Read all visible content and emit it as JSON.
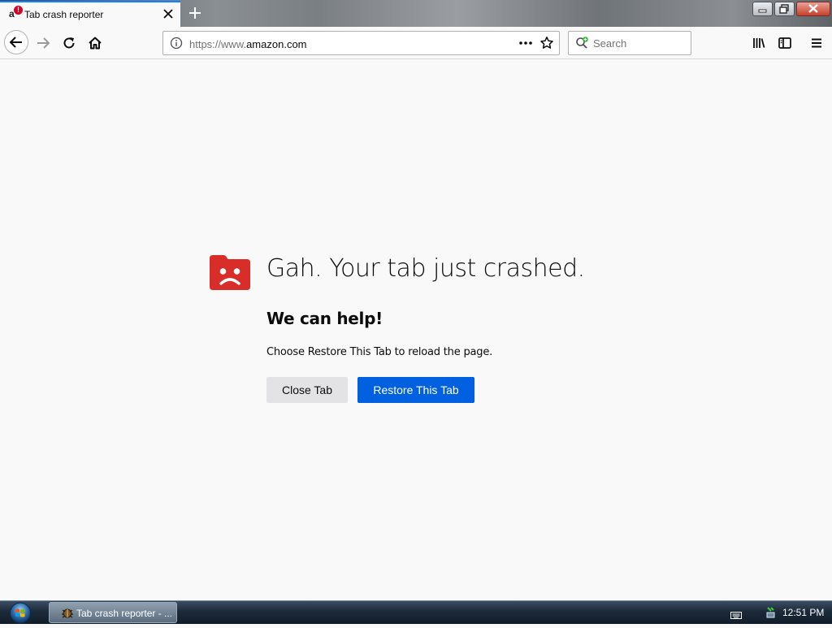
{
  "browser": {
    "tab": {
      "favicon_letter": "a",
      "crash_badge": "!",
      "title": "Tab crash reporter"
    },
    "url": {
      "scheme": "https://www.",
      "domain": "amazon.com"
    },
    "search": {
      "placeholder": "Search"
    }
  },
  "crash_page": {
    "title": "Gah. Your tab just crashed.",
    "subtitle": "We can help!",
    "message": "Choose Restore This Tab to reload the page.",
    "close_button": "Close Tab",
    "restore_button": "Restore This Tab"
  },
  "taskbar": {
    "task_label": "Tab crash reporter - ...",
    "clock": "12:51 PM"
  },
  "colors": {
    "accent": "#0060df",
    "crash_red": "#d92d29",
    "tab_highlight": "#0a84ff"
  },
  "icons": [
    "back-arrow-icon",
    "forward-arrow-icon",
    "reload-icon",
    "home-icon",
    "info-icon",
    "page-actions-icon",
    "bookmark-star-icon",
    "search-engine-icon",
    "library-icon",
    "sidebar-icon",
    "hamburger-menu-icon",
    "sad-tab-icon",
    "windows-start-icon"
  ]
}
